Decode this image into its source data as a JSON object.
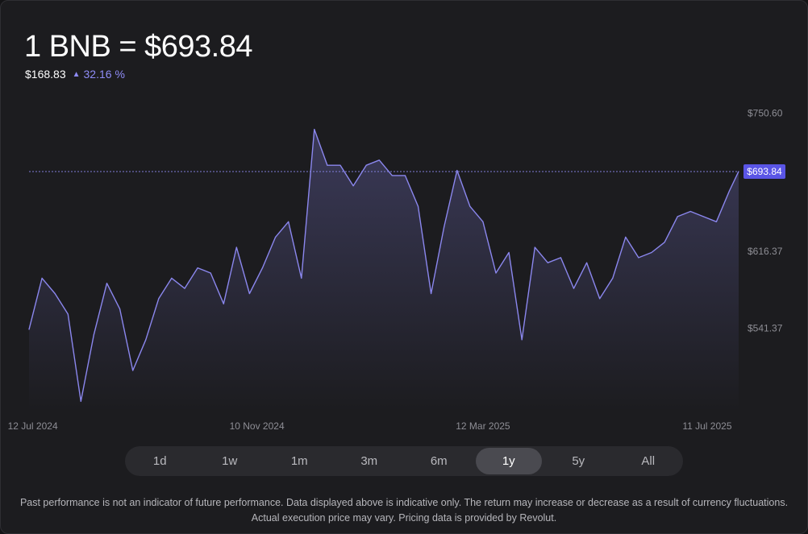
{
  "header": {
    "headline": "1 BNB = $693.84",
    "abs_change": "$168.83",
    "pct_change": "32.16 %"
  },
  "colors": {
    "line": "#8b87ee",
    "accent_tag": "#5a55e6",
    "background": "#1c1c1f"
  },
  "timeframes": {
    "items": [
      "1d",
      "1w",
      "1m",
      "3m",
      "6m",
      "1y",
      "5y",
      "All"
    ],
    "active": "1y"
  },
  "disclaimer": "Past performance is not an indicator of future performance. Data displayed above is indicative only. The return may increase or decrease as a result of currency fluctuations. Actual execution price may vary. Pricing data is provided by Revolut.",
  "chart_data": {
    "type": "area",
    "title": "1 BNB = $693.84",
    "xlabel": "",
    "ylabel": "",
    "x_ticks": [
      "12 Jul 2024",
      "10 Nov 2024",
      "12 Mar 2025",
      "11 Jul 2025"
    ],
    "y_ticks": [
      "$750.60",
      "$616.37",
      "$541.37"
    ],
    "current_price_label": "$693.84",
    "current_price": 693.84,
    "ylim": [
      460,
      770
    ],
    "grid": false,
    "legend": "none",
    "series": [
      {
        "x": [
          "2024-07-10",
          "2024-07-17",
          "2024-07-24",
          "2024-07-31",
          "2024-08-07",
          "2024-08-14",
          "2024-08-21",
          "2024-08-28",
          "2024-09-04",
          "2024-09-11",
          "2024-09-18",
          "2024-09-25",
          "2024-10-02",
          "2024-10-09",
          "2024-10-16",
          "2024-10-23",
          "2024-10-30",
          "2024-11-06",
          "2024-11-13",
          "2024-11-20",
          "2024-11-27",
          "2024-12-04",
          "2024-12-11",
          "2024-12-18",
          "2024-12-25",
          "2025-01-01",
          "2025-01-08",
          "2025-01-15",
          "2025-01-22",
          "2025-01-29",
          "2025-02-05",
          "2025-02-12",
          "2025-02-19",
          "2025-02-26",
          "2025-03-05",
          "2025-03-12",
          "2025-03-19",
          "2025-03-26",
          "2025-04-02",
          "2025-04-09",
          "2025-04-16",
          "2025-04-23",
          "2025-04-30",
          "2025-05-07",
          "2025-05-14",
          "2025-05-21",
          "2025-05-28",
          "2025-06-04",
          "2025-06-11",
          "2025-06-18",
          "2025-06-25",
          "2025-07-02",
          "2025-07-09",
          "2025-07-16",
          "2025-07-23",
          "2025-07-28"
        ],
        "values": [
          540,
          590,
          575,
          555,
          470,
          535,
          585,
          560,
          500,
          530,
          570,
          590,
          580,
          600,
          595,
          565,
          620,
          575,
          600,
          630,
          645,
          590,
          735,
          700,
          700,
          680,
          700,
          705,
          690,
          690,
          660,
          575,
          640,
          695,
          660,
          645,
          595,
          615,
          530,
          620,
          605,
          610,
          580,
          605,
          570,
          590,
          630,
          610,
          615,
          625,
          650,
          655,
          650,
          645,
          675,
          694
        ]
      }
    ]
  }
}
